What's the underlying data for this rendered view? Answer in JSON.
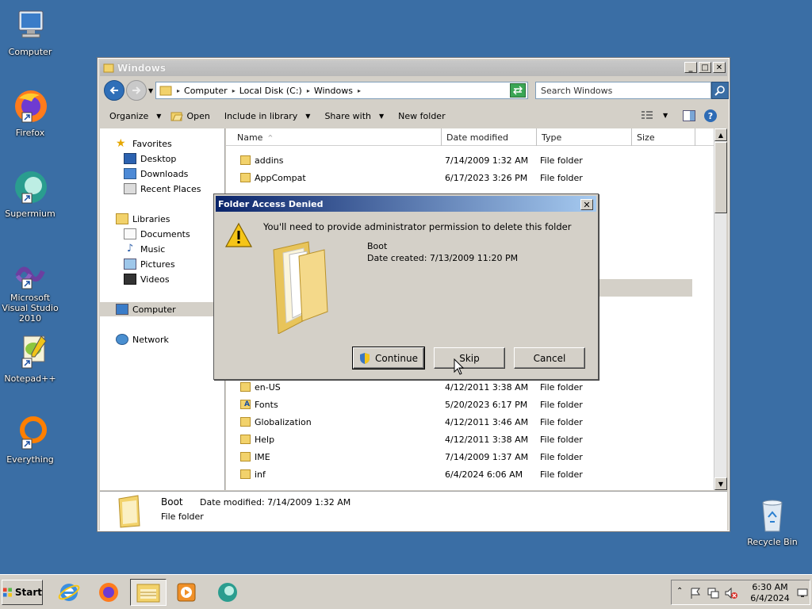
{
  "desktop": {
    "icons": [
      {
        "label": "Computer"
      },
      {
        "label": "Firefox"
      },
      {
        "label": "Supermium"
      },
      {
        "label": "Microsoft Visual Studio 2010"
      },
      {
        "label": "Notepad++"
      },
      {
        "label": "Everything"
      },
      {
        "label": "Recycle Bin"
      }
    ]
  },
  "explorer": {
    "title": "Windows",
    "breadcrumb": [
      "Computer",
      "Local Disk (C:)",
      "Windows"
    ],
    "search_placeholder": "Search Windows",
    "toolbar": {
      "organize": "Organize",
      "open": "Open",
      "include": "Include in library",
      "share": "Share with",
      "new_folder": "New folder"
    },
    "nav": {
      "favorites": "Favorites",
      "desktop": "Desktop",
      "downloads": "Downloads",
      "recent": "Recent Places",
      "libraries": "Libraries",
      "documents": "Documents",
      "music": "Music",
      "pictures": "Pictures",
      "videos": "Videos",
      "computer": "Computer",
      "network": "Network"
    },
    "columns": {
      "name": "Name",
      "date": "Date modified",
      "type": "Type",
      "size": "Size"
    },
    "files": [
      {
        "name": "addins",
        "date": "7/14/2009 1:32 AM",
        "type": "File folder"
      },
      {
        "name": "AppCompat",
        "date": "6/17/2023 3:26 PM",
        "type": "File folder"
      },
      {
        "name": "en-US",
        "date": "4/12/2011 3:38 AM",
        "type": "File folder"
      },
      {
        "name": "Fonts",
        "date": "5/20/2023 6:17 PM",
        "type": "File folder"
      },
      {
        "name": "Globalization",
        "date": "4/12/2011 3:46 AM",
        "type": "File folder"
      },
      {
        "name": "Help",
        "date": "4/12/2011 3:38 AM",
        "type": "File folder"
      },
      {
        "name": "IME",
        "date": "7/14/2009 1:37 AM",
        "type": "File folder"
      },
      {
        "name": "inf",
        "date": "6/4/2024 6:06 AM",
        "type": "File folder"
      }
    ],
    "details": {
      "name": "Boot",
      "modified": "Date modified: 7/14/2009 1:32 AM",
      "type": "File folder"
    }
  },
  "dialog": {
    "title": "Folder Access Denied",
    "message": "You'll need to provide administrator permission to delete this folder",
    "item_name": "Boot",
    "item_created": "Date created: 7/13/2009 11:20 PM",
    "continue": "Continue",
    "skip": "Skip",
    "cancel": "Cancel"
  },
  "taskbar": {
    "start": "Start",
    "time": "6:30 AM",
    "date": "6/4/2024"
  }
}
